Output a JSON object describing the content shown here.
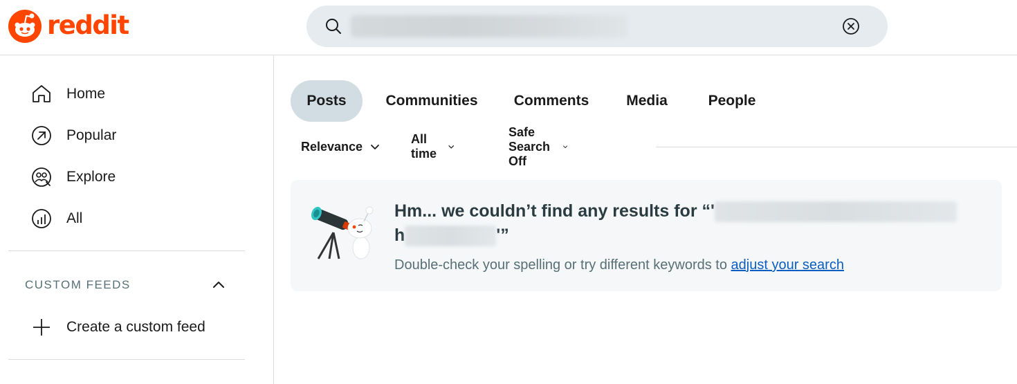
{
  "header": {
    "logo_text": "reddit",
    "brand_color": "#ff4500",
    "search": {
      "value": "",
      "placeholder": "",
      "clear_icon": "close-circle-icon"
    }
  },
  "sidebar": {
    "items": [
      {
        "label": "Home",
        "icon": "home-icon"
      },
      {
        "label": "Popular",
        "icon": "popular-arrow-icon"
      },
      {
        "label": "Explore",
        "icon": "explore-icon"
      },
      {
        "label": "All",
        "icon": "chart-icon"
      }
    ],
    "custom_feeds": {
      "heading": "CUSTOM FEEDS",
      "create_label": "Create a custom feed"
    }
  },
  "tabs": [
    {
      "label": "Posts",
      "active": true
    },
    {
      "label": "Communities",
      "active": false
    },
    {
      "label": "Comments",
      "active": false
    },
    {
      "label": "Media",
      "active": false
    },
    {
      "label": "People",
      "active": false
    }
  ],
  "filters": {
    "sort": "Relevance",
    "time": "All time",
    "safe_search": "Safe Search Off"
  },
  "empty_state": {
    "title_prefix": "Hm... we couldn’t find any results for “'",
    "title_mid": "h",
    "title_suffix": "'”",
    "subtitle": "Double-check your spelling or try different keywords to ",
    "link": "adjust your search"
  }
}
